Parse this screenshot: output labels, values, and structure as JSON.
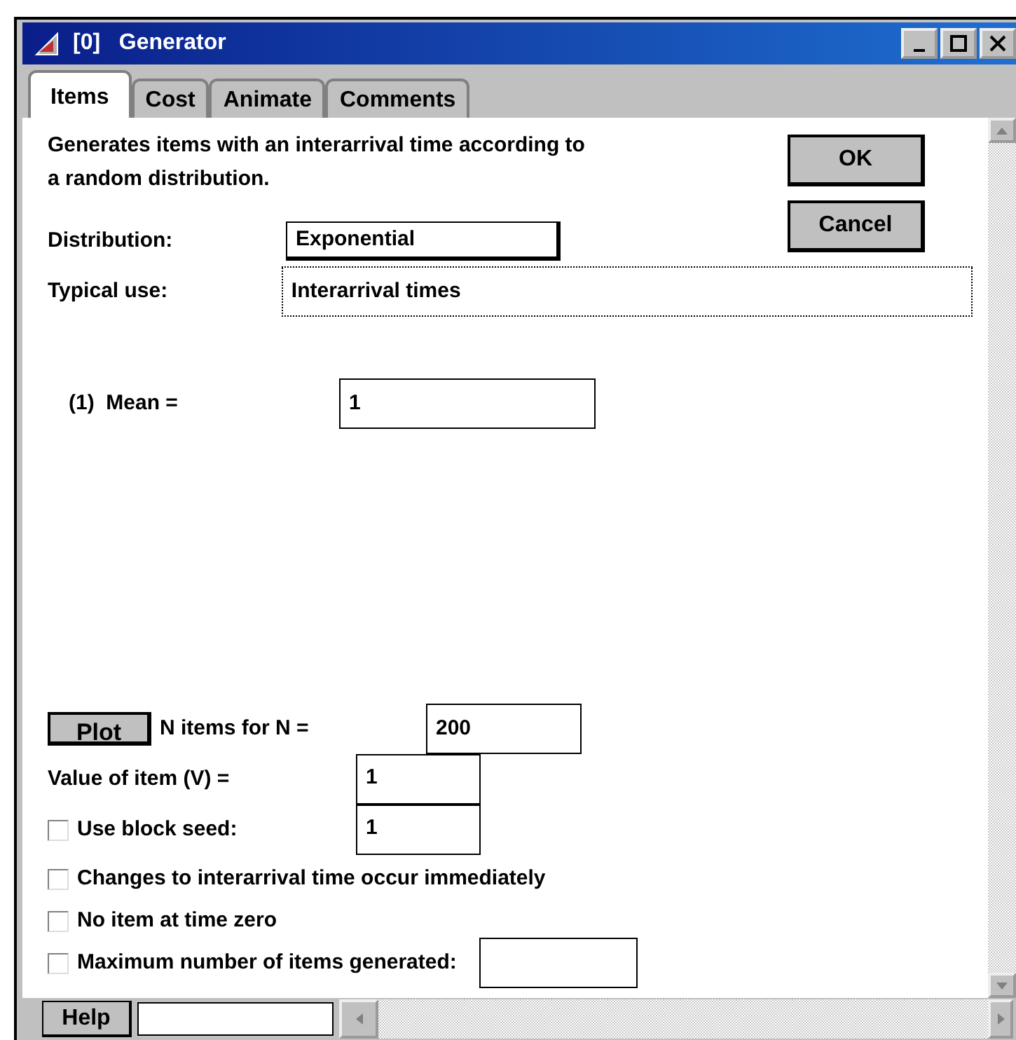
{
  "window": {
    "title": "[0]   Generator"
  },
  "tabs": [
    {
      "label": "Items",
      "selected": true
    },
    {
      "label": "Cost",
      "selected": false
    },
    {
      "label": "Animate",
      "selected": false
    },
    {
      "label": "Comments",
      "selected": false
    }
  ],
  "description": "Generates items with an interarrival time according to a random distribution.",
  "buttons": [
    "OK",
    "Cancel"
  ],
  "distribution": {
    "label": "Distribution:",
    "value": "Exponential"
  },
  "typical_use": {
    "label": "Typical use:",
    "value": "Interarrival times"
  },
  "parameters": [
    {
      "label": "(1)  Mean =",
      "value": "1"
    }
  ],
  "plot": {
    "button": "Plot",
    "label": "N items for N =",
    "value": "200"
  },
  "value_of_item": {
    "label": "Value of item (V) =",
    "value": "1"
  },
  "options": [
    {
      "kind": "checkbox_field",
      "label": "Use block seed:",
      "checked": false,
      "value": "1"
    },
    {
      "kind": "checkbox",
      "label": "Changes to interarrival time occur immediately",
      "checked": false
    },
    {
      "kind": "checkbox",
      "label": "No item at time zero",
      "checked": false
    },
    {
      "kind": "checkbox_field",
      "label": "Maximum number of items generated:",
      "checked": false
    }
  ],
  "help": {
    "button": "Help"
  }
}
